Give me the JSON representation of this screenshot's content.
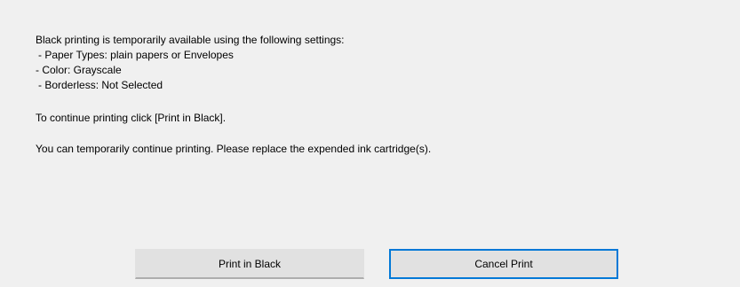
{
  "message": {
    "intro": "Black printing is temporarily available using the following settings:",
    "settings": [
      "- Paper Types: plain papers or Envelopes",
      "- Color: Grayscale",
      "- Borderless: Not Selected"
    ],
    "continue_instruction": "To continue printing click [Print in Black].",
    "replace_notice": "You can temporarily continue printing. Please replace the expended ink cartridge(s)."
  },
  "buttons": {
    "print_in_black": "Print in Black",
    "cancel_print": "Cancel Print"
  },
  "colors": {
    "background": "#f0f0f0",
    "button_face": "#e1e1e1",
    "focus_border": "#0078d7"
  }
}
